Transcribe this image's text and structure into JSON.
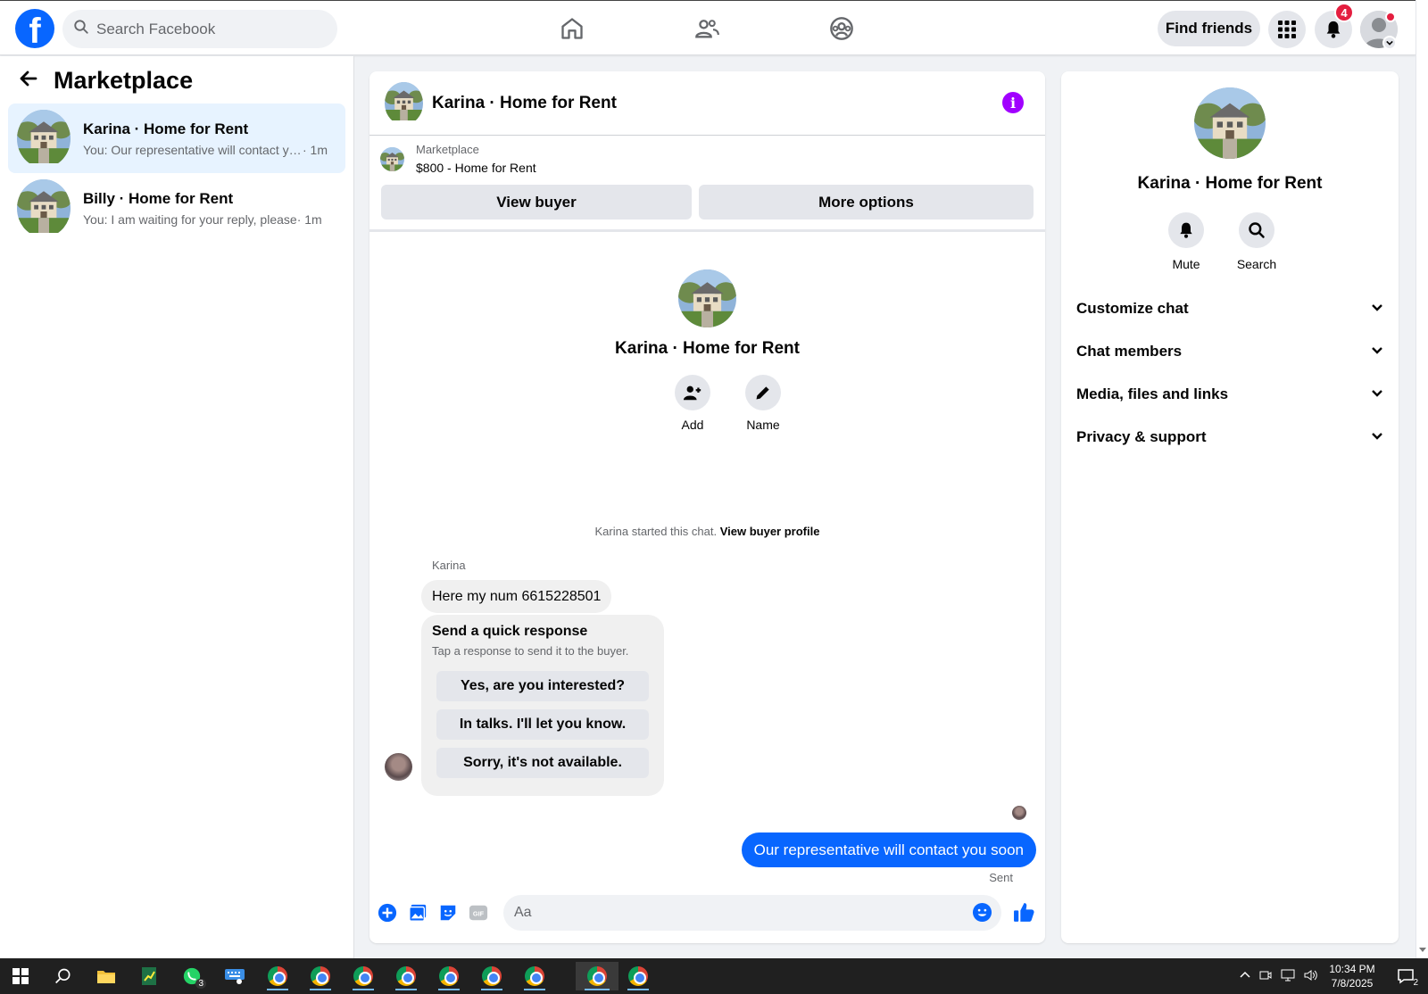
{
  "header": {
    "search_placeholder": "Search Facebook",
    "find_friends_label": "Find friends",
    "notifications_count": "4"
  },
  "sidebar": {
    "title": "Marketplace",
    "conversations": [
      {
        "name": "Karina · Home for Rent",
        "preview": "You: Our representative will contact you soon",
        "time": " · 1m"
      },
      {
        "name": "Billy · Home for Rent",
        "preview": "You: I am waiting for your reply, please",
        "time": " · 1m"
      }
    ]
  },
  "chat": {
    "title": "Karina · Home for Rent",
    "listing_label": "Marketplace",
    "listing_price": "$800 - Home for Rent",
    "view_buyer_label": "View buyer",
    "more_options_label": "More options",
    "profile_name": "Karina · Home for Rent",
    "add_label": "Add",
    "name_label": "Name",
    "started_text": "Karina started this chat.",
    "view_profile_link": "View buyer profile",
    "sender_name": "Karina",
    "incoming_message": "Here my num 6615228501",
    "quick_title": "Send a quick response",
    "quick_subtitle": "Tap a response to send it to the buyer.",
    "quick_responses": [
      "Yes, are you interested?",
      "In talks. I'll let you know.",
      "Sorry, it's not available."
    ],
    "outgoing_message": "Our representative will contact you soon",
    "sent_label": "Sent",
    "composer_placeholder": "Aa",
    "gif_label": "GIF"
  },
  "info_panel": {
    "name": "Karina · Home for Rent",
    "mute_label": "Mute",
    "search_label": "Search",
    "sections": [
      "Customize chat",
      "Chat members",
      "Media, files and links",
      "Privacy & support"
    ]
  },
  "taskbar": {
    "whatsapp_badge": "3",
    "time": "10:34 PM",
    "date": "7/8/2025",
    "notification_count": "2"
  },
  "colors": {
    "brand_blue": "#0866ff",
    "info_purple": "#a100ff",
    "badge_red": "#e41e3f",
    "active_conversation": "#e7f3ff"
  }
}
